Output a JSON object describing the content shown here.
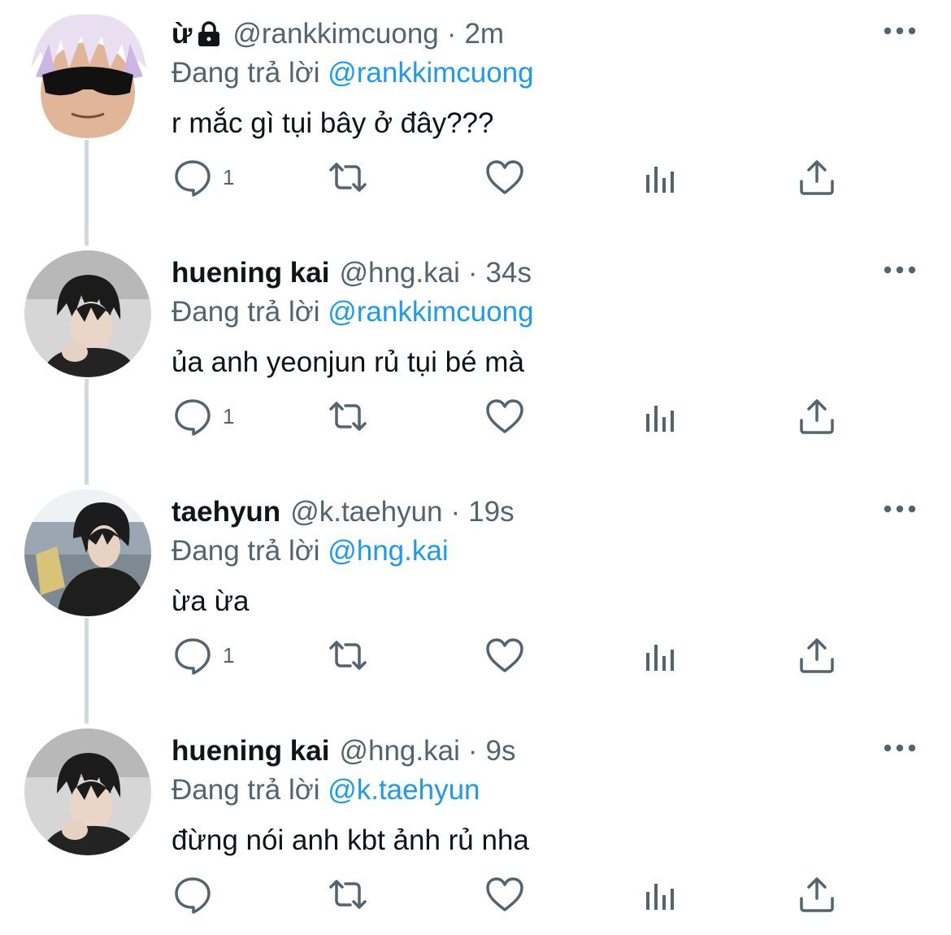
{
  "tweets": [
    {
      "display_name": "ừ",
      "protected": true,
      "handle": "@rankkimcuong",
      "separator": "·",
      "time": "2m",
      "reply_prefix": "Đang trả lời",
      "reply_to": "@rankkimcuong",
      "text": "r mắc gì tụi bây ở đây???",
      "reply_count": "1",
      "avatar": "avatar-person-sunglasses-white-hair"
    },
    {
      "display_name": "huening kai",
      "protected": false,
      "handle": "@hng.kai",
      "separator": "·",
      "time": "34s",
      "reply_prefix": "Đang trả lời",
      "reply_to": "@rankkimcuong",
      "text": "ủa anh yeonjun rủ tụi bé mà",
      "reply_count": "1",
      "avatar": "avatar-person-dark-hair"
    },
    {
      "display_name": "taehyun",
      "protected": false,
      "handle": "@k.taehyun",
      "separator": "·",
      "time": "19s",
      "reply_prefix": "Đang trả lời",
      "reply_to": "@hng.kai",
      "text": "ừa ừa",
      "reply_count": "1",
      "avatar": "avatar-person-outdoor"
    },
    {
      "display_name": "huening kai",
      "protected": false,
      "handle": "@hng.kai",
      "separator": "·",
      "time": "9s",
      "reply_prefix": "Đang trả lời",
      "reply_to": "@k.taehyun",
      "text": "đừng nói anh kbt ảnh rủ nha",
      "reply_count": "",
      "avatar": "avatar-person-dark-hair"
    }
  ],
  "icons": {
    "reply": "reply-icon",
    "retweet": "retweet-icon",
    "like": "heart-icon",
    "views": "analytics-icon",
    "share": "share-icon",
    "more": "more-icon",
    "lock": "lock-icon"
  },
  "colors": {
    "text": "#0f1419",
    "secondary": "#536471",
    "mention": "#1d9bf0",
    "thread_line": "#cfd9de"
  }
}
